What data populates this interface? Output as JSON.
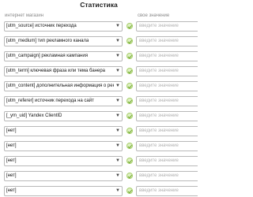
{
  "title": "Статистика",
  "columns": {
    "left": "интернет магазин",
    "right": "свое значение"
  },
  "rows": [
    {
      "value": "[utm_source] источник перехода",
      "placeholder": "введите значение"
    },
    {
      "value": "[utm_medium] тип рекламного канала",
      "placeholder": "введите значение"
    },
    {
      "value": "[utm_campaign] рекламная кампания",
      "placeholder": "введите значение"
    },
    {
      "value": "[utm_term] ключевая фраза или тема банера",
      "placeholder": "введите значение"
    },
    {
      "value": "[utm_content] дополнительная информация о рекламе",
      "placeholder": "введите значение"
    },
    {
      "value": "[utm_referer] источник перехода на сайт",
      "placeholder": "введите значение"
    },
    {
      "value": "[_ym_uid] Yandex ClientID",
      "placeholder": "введите значение"
    },
    {
      "value": "[нет]",
      "placeholder": "введите значение"
    },
    {
      "value": "[нет]",
      "placeholder": "введите значение"
    },
    {
      "value": "[нет]",
      "placeholder": "введите значение"
    },
    {
      "value": "[нет]",
      "placeholder": "введите значение"
    },
    {
      "value": "[нет]",
      "placeholder": "введите значение"
    }
  ]
}
